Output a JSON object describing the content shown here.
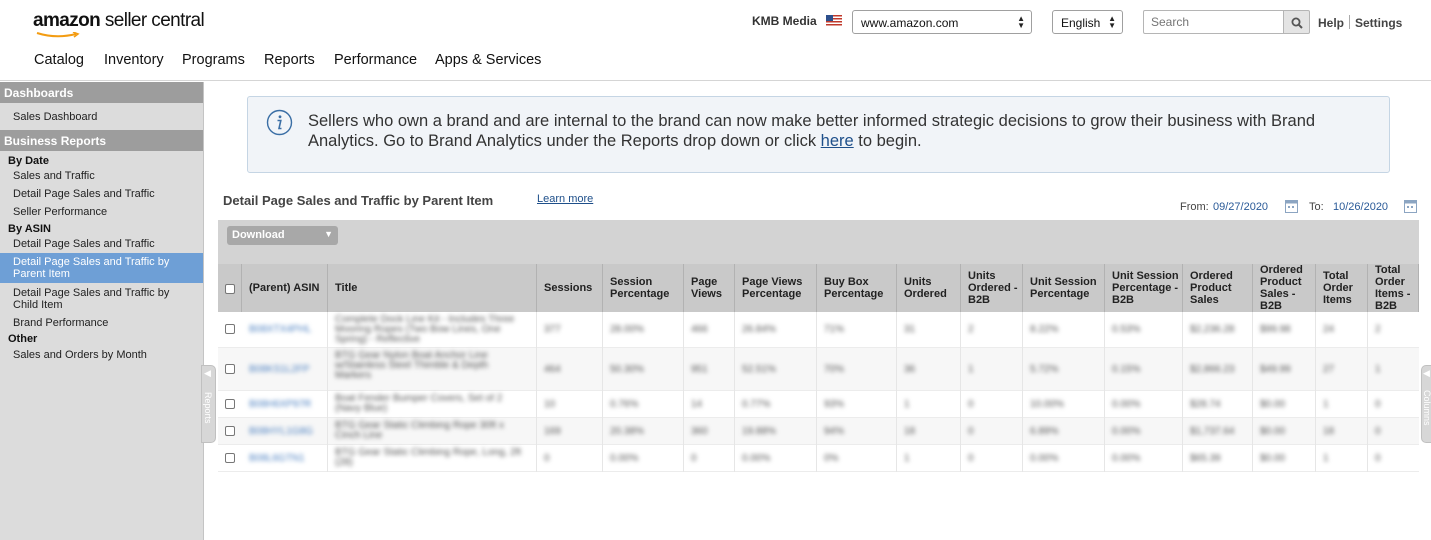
{
  "header": {
    "logo_prefix": "amazon",
    "logo_suffix": "seller central",
    "account": "KMB Media",
    "marketplace": "www.amazon.com",
    "language": "English",
    "search_placeholder": "Search",
    "help": "Help",
    "settings": "Settings"
  },
  "nav": {
    "items": [
      "Catalog",
      "Inventory",
      "Programs",
      "Reports",
      "Performance",
      "Apps & Services"
    ]
  },
  "sidebar": {
    "dashboards_head": "Dashboards",
    "sales_dashboard": "Sales Dashboard",
    "business_reports_head": "Business Reports",
    "by_date": "By Date",
    "sales_and_traffic": "Sales and Traffic",
    "detail_page_sales_traffic": "Detail Page Sales and Traffic",
    "seller_performance": "Seller Performance",
    "by_asin": "By ASIN",
    "asin_detail_page": "Detail Page Sales and Traffic",
    "parent_item_line1": "Detail Page Sales and Traffic by",
    "parent_item_line2": "Parent Item",
    "child_item_line1": "Detail Page Sales and Traffic by",
    "child_item_line2": "Child Item",
    "brand_performance": "Brand Performance",
    "other": "Other",
    "sales_orders_month": "Sales and Orders by Month",
    "reports_tab": "Reports",
    "columns_tab": "Columns"
  },
  "banner": {
    "text_before": "Sellers who own a brand and are internal to the brand can now make better informed strategic decisions to grow their business with Brand Analytics. Go to Brand Analytics under the Reports drop down or click ",
    "link": "here",
    "text_after": " to begin."
  },
  "report": {
    "title": "Detail Page Sales and Traffic by Parent Item",
    "learn_more": "Learn more",
    "from_label": "From:",
    "from_date": "09/27/2020",
    "to_label": "To:",
    "to_date": "10/26/2020",
    "download_label": "Download"
  },
  "table": {
    "headers": [
      "(Parent) ASIN",
      "Title",
      "Sessions",
      "Session Percentage",
      "Page Views",
      "Page Views Percentage",
      "Buy Box Percentage",
      "Units Ordered",
      "Units Ordered - B2B",
      "Unit Session Percentage",
      "Unit Session Percentage - B2B",
      "Ordered Product Sales",
      "Ordered Product Sales - B2B",
      "Total Order Items",
      "Total Order Items - B2B"
    ],
    "rows": [
      [
        "B08XTX4PHL",
        "Complete Dock Line Kit - Includes Three Mooring Ropes (Two Bow Lines, One Spring) - Reflective",
        "377",
        "28.00%",
        "466",
        "26.84%",
        "71%",
        "31",
        "2",
        "8.22%",
        "0.53%",
        "$2,236.28",
        "$99.98",
        "24",
        "2"
      ],
      [
        "B08KS1L2FP",
        "BTG Gear Nylon Boat Anchor Line w/Stainless Steel Thimble & Depth Markers",
        "464",
        "50.30%",
        "951",
        "52.51%",
        "70%",
        "36",
        "1",
        "5.72%",
        "0.15%",
        "$2,866.23",
        "$49.99",
        "27",
        "1"
      ],
      [
        "B08H6XP97R",
        "Boat Fender Bumper Covers, Set of 2 (Navy Blue)",
        "10",
        "0.76%",
        "14",
        "0.77%",
        "93%",
        "1",
        "0",
        "10.00%",
        "0.00%",
        "$28.74",
        "$0.00",
        "1",
        "0"
      ],
      [
        "B08HYL1G8G",
        "BTG Gear Static Climbing Rope 30ft x Cinch Line",
        "169",
        "20.38%",
        "360",
        "19.88%",
        "94%",
        "18",
        "0",
        "6.89%",
        "0.00%",
        "$1,737.64",
        "$0.00",
        "18",
        "0"
      ],
      [
        "B08L6GTN1",
        "BTG Gear Static Climbing Rope, Long, 2ft (28)",
        "0",
        "0.00%",
        "0",
        "0.00%",
        "0%",
        "1",
        "0",
        "0.00%",
        "0.00%",
        "$65.39",
        "$0.00",
        "1",
        "0"
      ]
    ]
  },
  "colors": {
    "sidebar_head": "#9d9d9d",
    "sidebar_active": "#6e9fd6",
    "link": "#1e4f8a",
    "banner_bg": "#f1f4f8"
  }
}
